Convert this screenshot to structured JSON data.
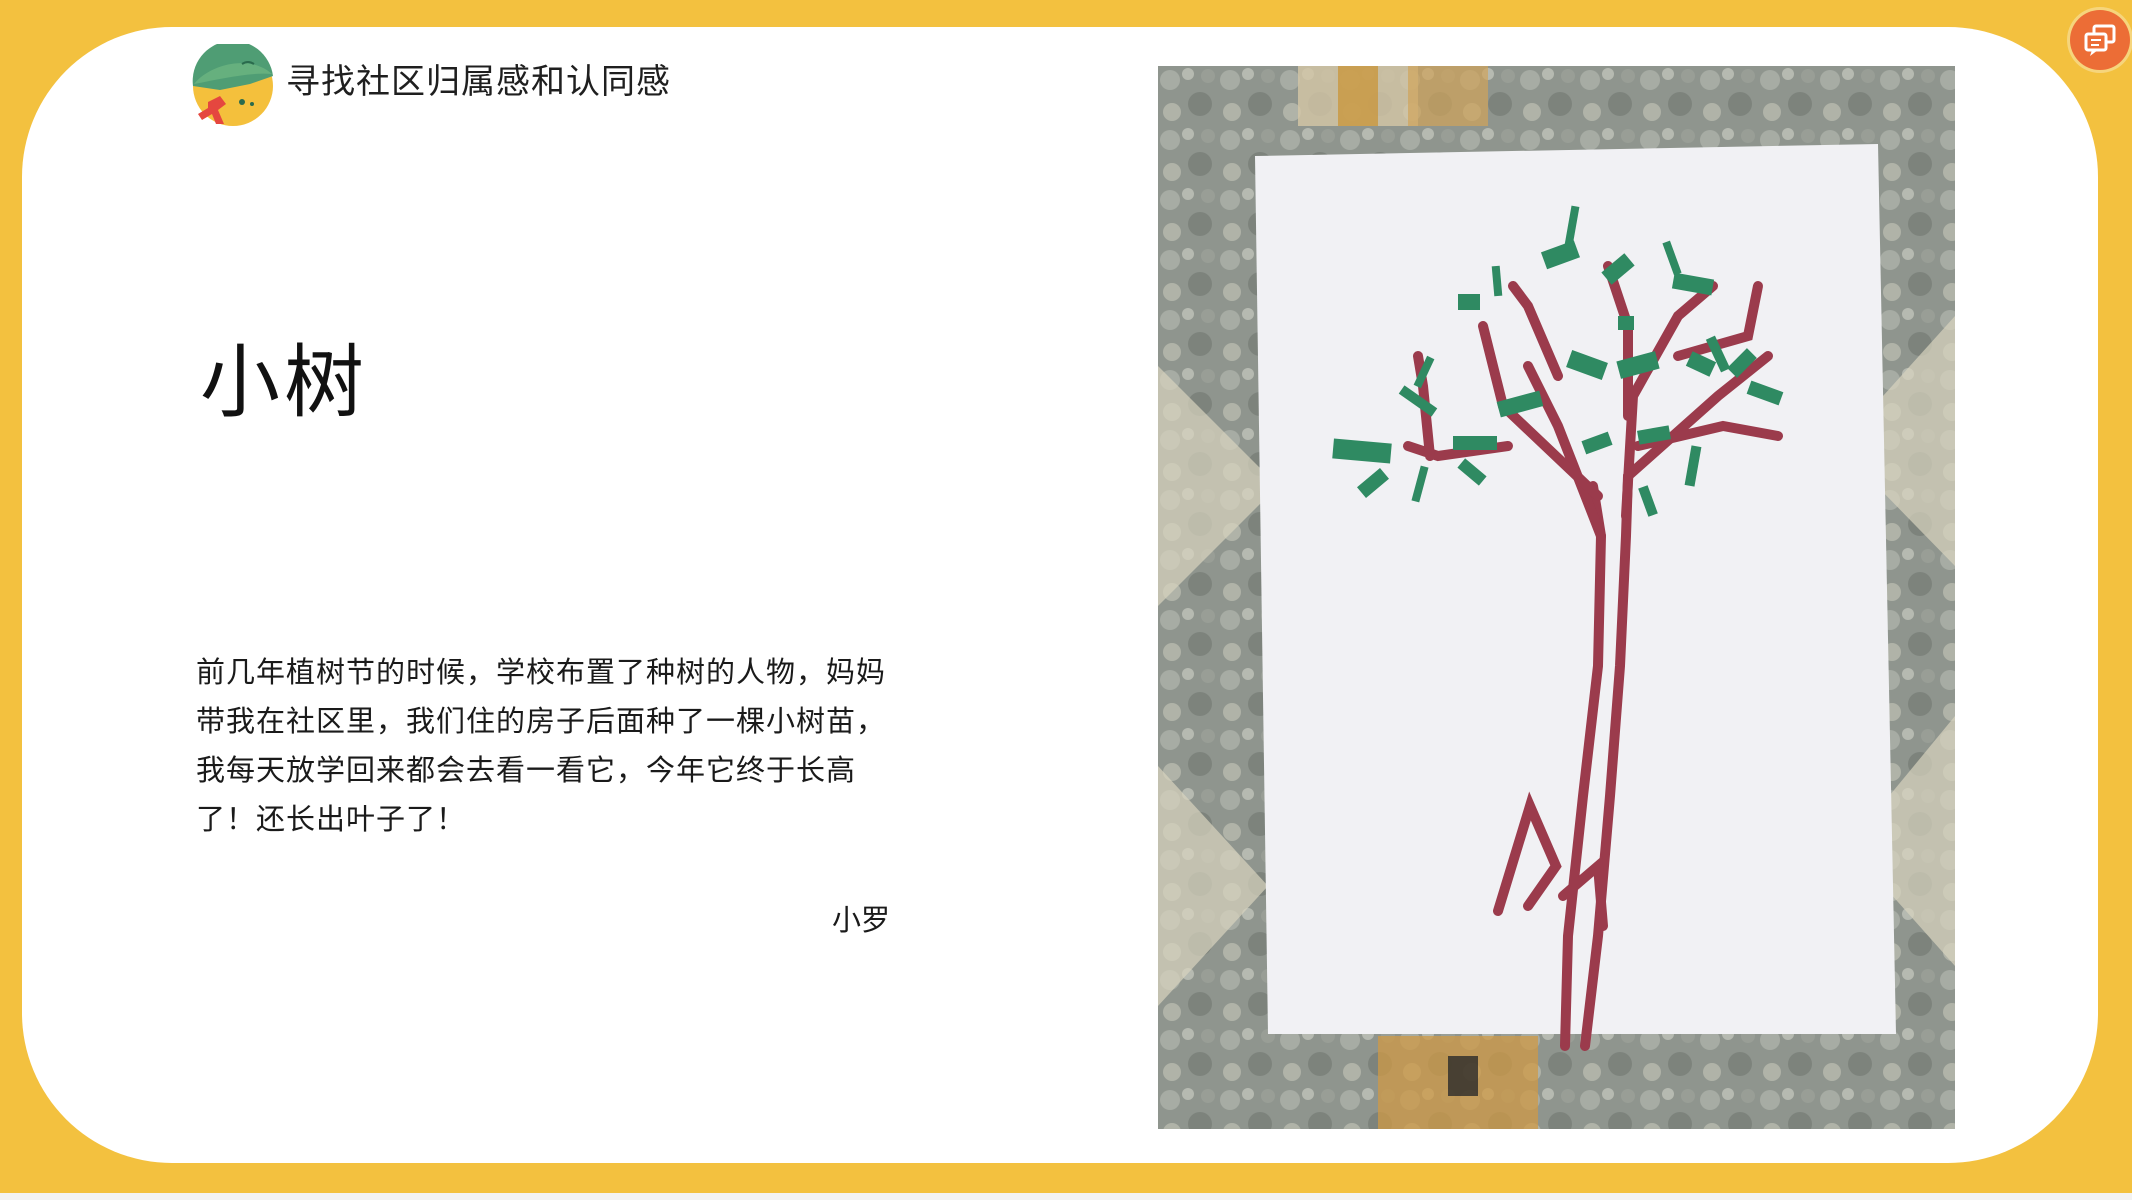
{
  "header": {
    "title": "寻找社区归属感和认同感",
    "logo_icon": "community-logo-icon"
  },
  "story": {
    "title": "小树",
    "body": "前几年植树节的时候，学校布置了种树的人物，妈妈带我在社区里，我们住的房子后面种了一棵小树苗，我每天放学回来都会去看一看它，今年它终于长高了！还长出叶子了！",
    "author": "小罗"
  },
  "photo": {
    "subject": "child-tree-drawing"
  },
  "toolbar": {
    "corner_button_icon": "comment-chat-icon"
  },
  "colors": {
    "frame": "#f3c13f",
    "card": "#ffffff",
    "accent_button": "#ec6d36",
    "trunk": "#9b3b4c",
    "leaves": "#2f8a62"
  }
}
